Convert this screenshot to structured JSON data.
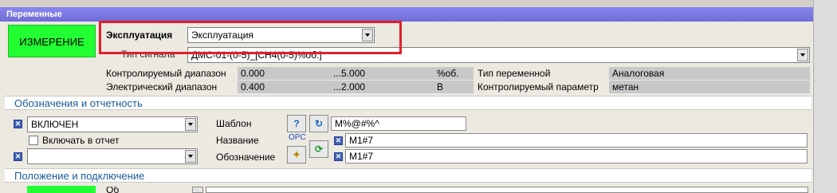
{
  "window": {
    "title": "Переменные"
  },
  "mode_button": {
    "label": "ИЗМЕРЕНИЕ"
  },
  "mode_field": {
    "label": "Эксплуатация",
    "value": "Эксплуатация"
  },
  "signal_type": {
    "label": "Тип сигнала",
    "value": "ДМС-01-(0-5)_[СН4(0-5)%об.]"
  },
  "ranges": {
    "control_label": "Контролируемый диапазон",
    "control_min": "0.000",
    "control_sep": "...",
    "control_max": "5.000",
    "control_unit": "%об.",
    "electric_label": "Электрический диапазон",
    "electric_min": "0.400",
    "electric_sep": "...",
    "electric_max": "2.000",
    "electric_unit": "В"
  },
  "variable_type": {
    "label": "Тип переменной",
    "value": "Аналоговая"
  },
  "controlled_param": {
    "label": "Контролируемый параметр",
    "value": "метан"
  },
  "section_reporting": {
    "title": "Обозначения и отчетность"
  },
  "state_combo": {
    "value": "ВКЛЮЧЕН"
  },
  "include_report": {
    "label": "Включать в отчет"
  },
  "template": {
    "label": "Шаблон",
    "value": "M%@#%^"
  },
  "name_field": {
    "label": "Название",
    "value": "M1#7",
    "opc": "OPC"
  },
  "designation": {
    "label": "Обозначение",
    "value": "M1#7"
  },
  "second_combo": {
    "value": ""
  },
  "section_position": {
    "title": "Положение и подключение"
  },
  "row_bottom": {
    "label": "Об",
    "value": "..."
  },
  "colors": {
    "title_bar": "#7a77e8",
    "active_green": "#22ff33",
    "highlight_red": "#e0202a",
    "section_text": "#1a5a9a"
  }
}
